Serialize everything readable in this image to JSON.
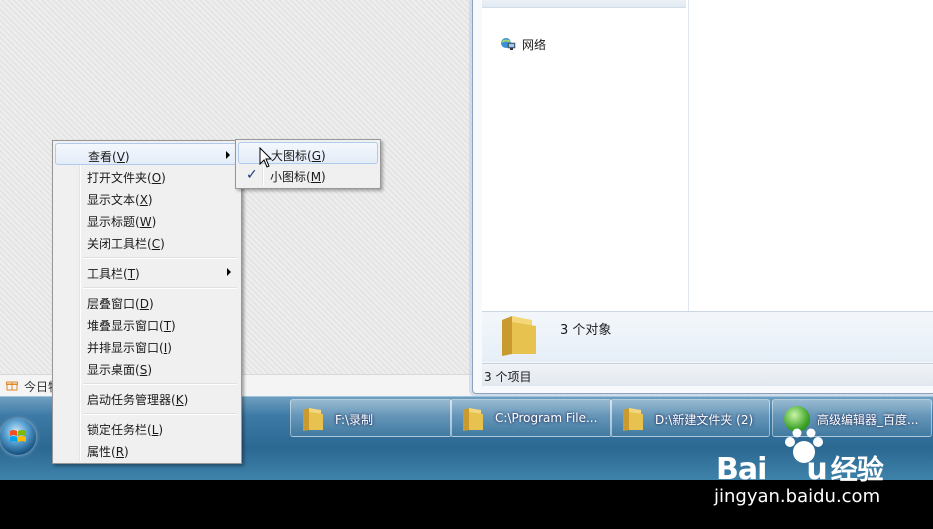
{
  "desktop": {
    "today_text": "今日特"
  },
  "explorer": {
    "nav_network_label": "网络",
    "details_count": "3 个对象",
    "status_text": "3 个项目"
  },
  "context_menu": {
    "items": [
      {
        "label": "查看(",
        "key": "V",
        "close": ")",
        "submenu": true
      },
      {
        "label": "打开文件夹(",
        "key": "O",
        "close": ")"
      },
      {
        "label": "显示文本(",
        "key": "X",
        "close": ")"
      },
      {
        "label": "显示标题(",
        "key": "W",
        "close": ")"
      },
      {
        "label": "关闭工具栏(",
        "key": "C",
        "close": ")"
      },
      {
        "label": "工具栏(",
        "key": "T",
        "close": ")",
        "submenu": true
      },
      {
        "label": "层叠窗口(",
        "key": "D",
        "close": ")"
      },
      {
        "label": "堆叠显示窗口(",
        "key": "T",
        "close": ")"
      },
      {
        "label": "并排显示窗口(",
        "key": "I",
        "close": ")"
      },
      {
        "label": "显示桌面(",
        "key": "S",
        "close": ")"
      },
      {
        "label": "启动任务管理器(",
        "key": "K",
        "close": ")"
      },
      {
        "label": "锁定任务栏(",
        "key": "L",
        "close": ")"
      },
      {
        "label": "属性(",
        "key": "R",
        "close": ")"
      }
    ]
  },
  "view_submenu": {
    "items": [
      {
        "label": "大图标(",
        "key": "G",
        "close": ")",
        "checked": false
      },
      {
        "label": "小图标(",
        "key": "M",
        "close": ")",
        "checked": true
      }
    ],
    "check_glyph": "✓"
  },
  "taskbar": {
    "buttons": [
      {
        "label": "F:\\录制",
        "icon": "folder-icon"
      },
      {
        "label": "C:\\Program File...",
        "icon": "folder-icon"
      },
      {
        "label": "D:\\新建文件夹 (2)",
        "icon": "folder-icon"
      },
      {
        "label": "高级编辑器_百度...",
        "icon": "baidu-browser-icon"
      }
    ]
  },
  "watermark": {
    "logo_latin": "Bai",
    "logo_latin2": "u",
    "logo_cn": "经验",
    "url": "jingyan.baidu.com"
  },
  "colors": {
    "taskbar": "#2b6892",
    "menu_bg": "#f0f0f0",
    "menu_highlight": "#e3ecf8",
    "folder": "#e8c24f"
  }
}
